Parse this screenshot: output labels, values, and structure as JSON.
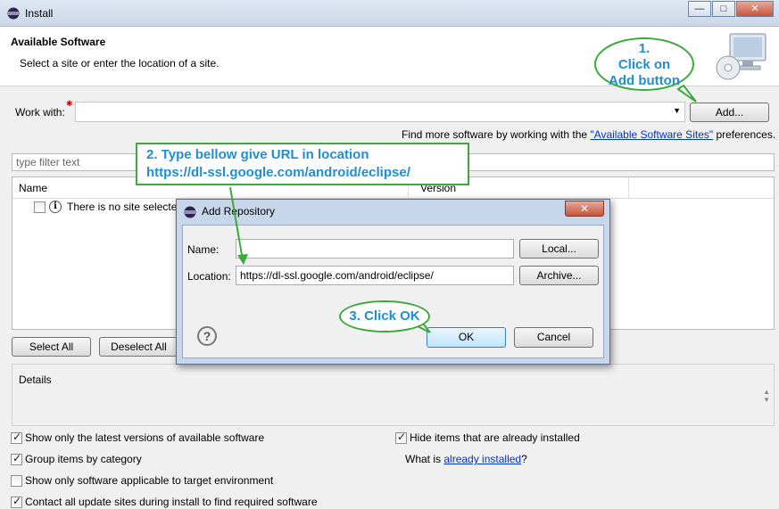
{
  "window": {
    "title": "Install",
    "controls": {
      "minimize": "—",
      "maximize": "□",
      "close": "✕"
    }
  },
  "header": {
    "title": "Available Software",
    "description": "Select a site or enter the location of a site."
  },
  "work_with": {
    "label": "Work with:",
    "add_button": "Add...",
    "find_more_prefix": "Find more software by working with the ",
    "find_more_link": "\"Available Software Sites\"",
    "find_more_suffix": " preferences."
  },
  "filter": {
    "placeholder": "type filter text"
  },
  "table": {
    "columns": [
      "Name",
      "Version"
    ],
    "rows": [
      {
        "text": "There is no site selected."
      }
    ]
  },
  "select_buttons": {
    "select_all": "Select All",
    "deselect_all": "Deselect All"
  },
  "details": {
    "label": "Details"
  },
  "options": {
    "latest_versions": {
      "label": "Show only the latest versions of available software",
      "checked": true
    },
    "group_by_category": {
      "label": "Group items by category",
      "checked": true
    },
    "applicable_only": {
      "label": "Show only software applicable to target environment",
      "checked": false
    },
    "contact_all": {
      "label": "Contact all update sites during install to find required software",
      "checked": true
    },
    "hide_installed": {
      "label": "Hide items that are already installed",
      "checked": true
    },
    "what_is_prefix": "What is ",
    "what_is_link": "already installed",
    "what_is_suffix": "?"
  },
  "dialog": {
    "title": "Add Repository",
    "close": "✕",
    "name_label": "Name:",
    "name_value": "",
    "location_label": "Location:",
    "location_value": "https://dl-ssl.google.com/android/eclipse/",
    "local_button": "Local...",
    "archive_button": "Archive...",
    "ok_button": "OK",
    "cancel_button": "Cancel",
    "help": "?"
  },
  "annotations": {
    "step1_line1": "1.",
    "step1_line2": "Click on",
    "step1_line3": "Add button",
    "step2_line1": "2. Type bellow give URL in location",
    "step2_line2": "https://dl-ssl.google.com/android/eclipse/",
    "step3": "3. Click OK"
  },
  "colors": {
    "annotation_border": "#3aaa3a",
    "annotation_text": "#1f8fd0",
    "link": "#0033cc",
    "close_button": "#c4543b"
  }
}
